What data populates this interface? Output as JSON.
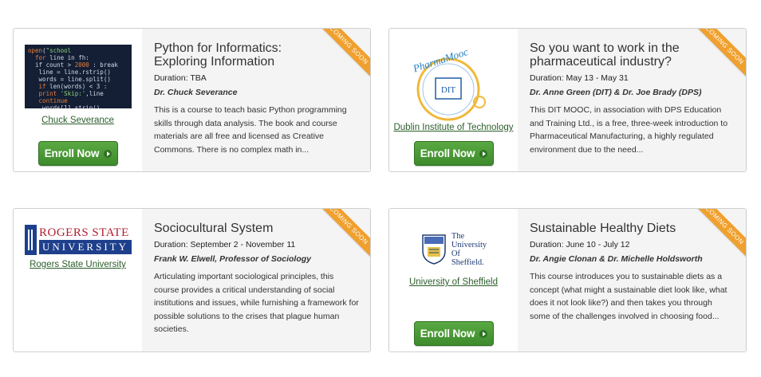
{
  "courses": [
    {
      "title": "Python for Informatics: Exploring Information",
      "duration": "Duration: TBA",
      "instructor": "Dr. Chuck Severance",
      "description": "This is a course to teach basic Python programming skills through data analysis. The book and course materials are all free and licensed as Creative Commons. There is no complex math in...",
      "institution": "Chuck Severance",
      "enroll_label": "Enroll Now",
      "ribbon": "COMING SOON"
    },
    {
      "title": "So you want to work in the pharmaceutical industry?",
      "duration": "Duration: May 13 - May 31",
      "instructor": "Dr. Anne Green (DIT) & Dr. Joe Brady (DPS)",
      "description": "This DIT MOOC, in association with DPS Education and Training Ltd., is a free, three-week introduction to Pharmaceutical Manufacturing, a highly regulated environment due to the need...",
      "institution": "Dublin Institute of Technology",
      "enroll_label": "Enroll Now",
      "ribbon": "COMING SOON",
      "logo_text": "PharmaMooc"
    },
    {
      "title": "Sociocultural System",
      "duration": "Duration: September 2 - November 11",
      "instructor": "Frank W. Elwell, Professor of Sociology",
      "description": "Articulating important sociological principles, this course provides a critical understanding of social institutions and issues, while furnishing a framework for possible solutions to the crises that plague human societies.",
      "institution": "Rogers State University",
      "ribbon": "COMING SOON",
      "logo_top": "ROGERS STATE",
      "logo_bottom": "UNIVERSITY"
    },
    {
      "title": "Sustainable Healthy Diets",
      "duration": "Duration: June 10 - July 12",
      "instructor": "Dr. Angie Clonan & Dr. Michelle Holdsworth",
      "description": "This course introduces you to sustainable diets as a concept (what might a sustainable diet look like, what does it not look like?) and then takes you through some of the challenges involved in choosing food...",
      "institution": "University of Sheffield",
      "enroll_label": "Enroll Now",
      "ribbon": "COMING SOON",
      "logo_line1": "The",
      "logo_line2": "University",
      "logo_line3": "Of",
      "logo_line4": "Sheffield."
    }
  ],
  "colors": {
    "accent_green": "#4a9a36",
    "ribbon_orange": "#f0a02e",
    "panel_gray": "#f4f4f4"
  }
}
